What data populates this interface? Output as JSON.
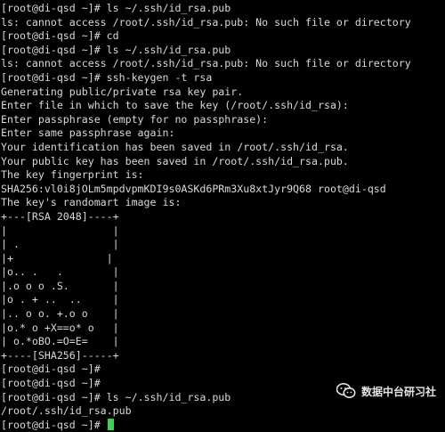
{
  "terminal": {
    "lines": [
      "[root@di-qsd ~]# ls ~/.ssh/id_rsa.pub",
      "ls: cannot access /root/.ssh/id_rsa.pub: No such file or directory",
      "[root@di-qsd ~]# cd",
      "[root@di-qsd ~]# ls ~/.ssh/id_rsa.pub",
      "ls: cannot access /root/.ssh/id_rsa.pub: No such file or directory",
      "[root@di-qsd ~]# ssh-keygen -t rsa",
      "Generating public/private rsa key pair.",
      "Enter file in which to save the key (/root/.ssh/id_rsa):",
      "Enter passphrase (empty for no passphrase):",
      "Enter same passphrase again:",
      "Your identification has been saved in /root/.ssh/id_rsa.",
      "Your public key has been saved in /root/.ssh/id_rsa.pub.",
      "The key fingerprint is:",
      "SHA256:vl0i8jOLm5mpdvpmKDI9s0ASKd6PRm3Xu8xtJyr9Q68 root@di-qsd",
      "The key's randomart image is:",
      "+---[RSA 2048]----+",
      "|                 |",
      "| .               |",
      "|+               |",
      "|o.. .   .        |",
      "|.o o o .S.       |",
      "|o . + ..  ..     |",
      "|.. o o. +.o o    |",
      "|o.* o +X==o* o   |",
      "| o.*oBO.=O=E=    |",
      "+----[SHA256]-----+",
      "[root@di-qsd ~]#",
      "[root@di-qsd ~]#",
      "[root@di-qsd ~]# ls ~/.ssh/id_rsa.pub",
      "/root/.ssh/id_rsa.pub"
    ],
    "prompt": "[root@di-qsd ~]# ",
    "cursor_color": "#39d353",
    "background_color": "#000000",
    "text_color": "#d9d9d9"
  },
  "watermark": {
    "text": "数据中台研习社",
    "icon": "wechat-icon"
  }
}
